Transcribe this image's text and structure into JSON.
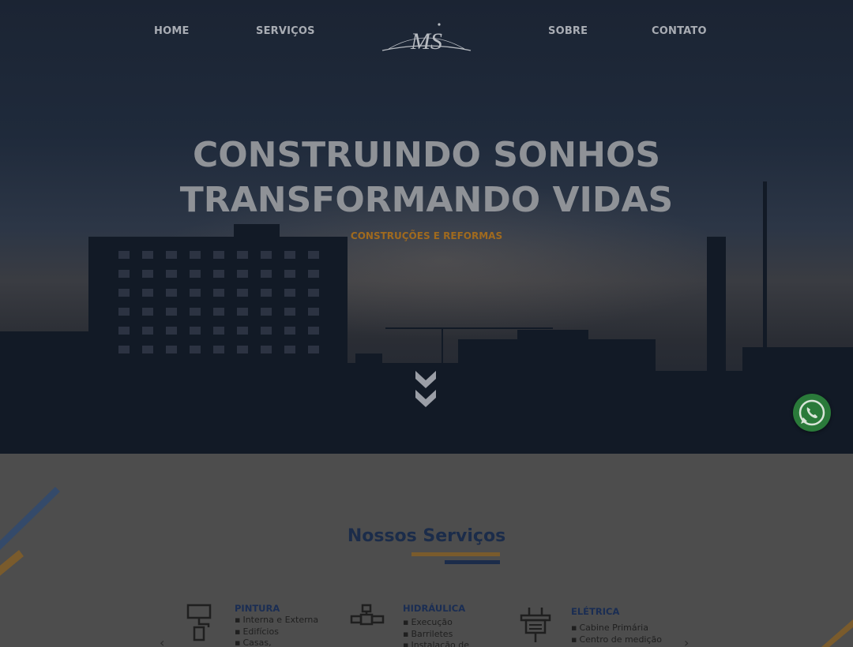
{
  "nav": {
    "items": [
      "HOME",
      "SERVIÇOS",
      "SOBRE",
      "CONTATO"
    ],
    "logo_text": "MS"
  },
  "hero": {
    "headline_line1": "CONSTRUINDO SONHOS",
    "headline_line2": "TRANSFORMANDO VIDAS",
    "subheadline": "CONSTRUÇÕES E REFORMAS",
    "scroll_icon": "double-chevron-down-icon"
  },
  "floating": {
    "whatsapp_icon": "whatsapp-icon",
    "whatsapp_color": "#2a7a3a"
  },
  "services": {
    "title": "Nossos Serviços",
    "items": [
      {
        "title": "PINTURA",
        "icon": "paint-roller-icon",
        "bullets": [
          "Interna e Externa",
          "Edifícios",
          "Casas,"
        ]
      },
      {
        "title": "HIDRÁULICA",
        "icon": "pipe-icon",
        "bullets": [
          "Execução",
          "Barriletes",
          "Instalação de"
        ]
      },
      {
        "title": "ELÉTRICA",
        "icon": "electric-plug-icon",
        "bullets": [
          "Cabine Primária",
          "Centro de medição"
        ]
      }
    ]
  },
  "colors": {
    "accent_orange": "#a06a1e",
    "navy": "#1b2c4a",
    "overlay_gray": "#4d4d4d"
  }
}
